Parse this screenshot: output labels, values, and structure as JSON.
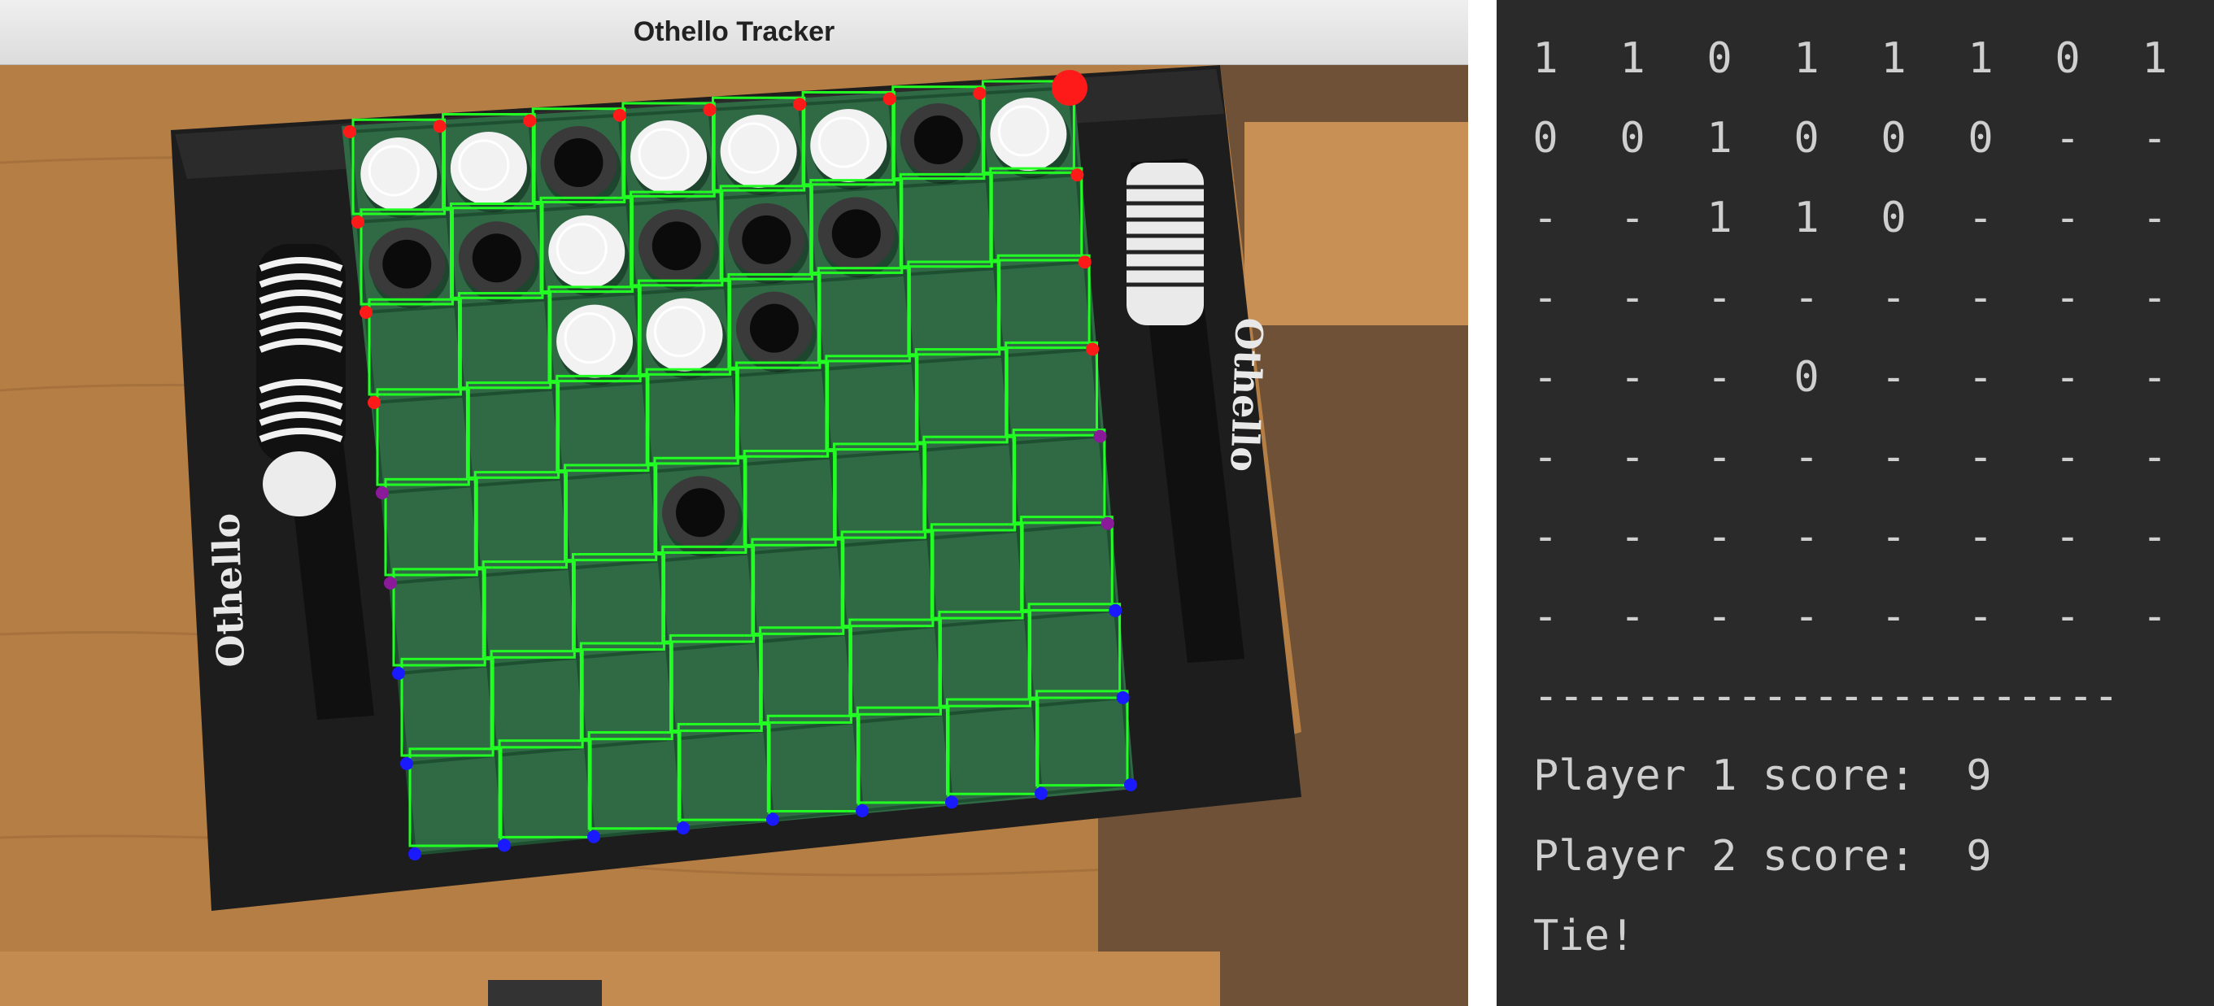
{
  "window": {
    "title": "Othello Tracker"
  },
  "board": {
    "brand_label": "Othello",
    "cells": [
      [
        "W",
        "W",
        "B",
        "W",
        "W",
        "W",
        "B",
        "W"
      ],
      [
        "B",
        "B",
        "W",
        "B",
        "B",
        "B",
        "",
        ""
      ],
      [
        "",
        "",
        "W",
        "W",
        "B",
        "",
        "",
        ""
      ],
      [
        "",
        "",
        "",
        "",
        "",
        "",
        "",
        ""
      ],
      [
        "",
        "",
        "",
        "B",
        "",
        "",
        "",
        ""
      ],
      [
        "",
        "",
        "",
        "",
        "",
        "",
        "",
        ""
      ],
      [
        "",
        "",
        "",
        "",
        "",
        "",
        "",
        ""
      ],
      [
        "",
        "",
        "",
        "",
        "",
        "",
        "",
        ""
      ]
    ],
    "colors": {
      "felt": "#2f6a45",
      "frame": "#1b1b1b",
      "table": "#b57e44",
      "grid_overlay": "#22ff22",
      "white_disc": "#f2f2f2",
      "black_disc": "#0b0b0b",
      "corner_marker_top": "#ff1a1a",
      "corner_marker_bottom": "#1a1aff"
    }
  },
  "terminal": {
    "rows": [
      [
        "1",
        "1",
        "0",
        "1",
        "1",
        "1",
        "0",
        "1"
      ],
      [
        "0",
        "0",
        "1",
        "0",
        "0",
        "0",
        "-",
        "-"
      ],
      [
        "-",
        "-",
        "1",
        "1",
        "0",
        "-",
        "-",
        "-"
      ],
      [
        "-",
        "-",
        "-",
        "-",
        "-",
        "-",
        "-",
        "-"
      ],
      [
        "-",
        "-",
        "-",
        "0",
        "-",
        "-",
        "-",
        "-"
      ],
      [
        "-",
        "-",
        "-",
        "-",
        "-",
        "-",
        "-",
        "-"
      ],
      [
        "-",
        "-",
        "-",
        "-",
        "-",
        "-",
        "-",
        "-"
      ],
      [
        "-",
        "-",
        "-",
        "-",
        "-",
        "-",
        "-",
        "-"
      ]
    ],
    "separator": "-----------------------",
    "player1_score": "Player 1 score:  9",
    "player2_score": "Player 2 score:  9",
    "result": "Tie!",
    "colors": {
      "background": "#2a2a2a",
      "text": "#cfcfcf"
    }
  }
}
